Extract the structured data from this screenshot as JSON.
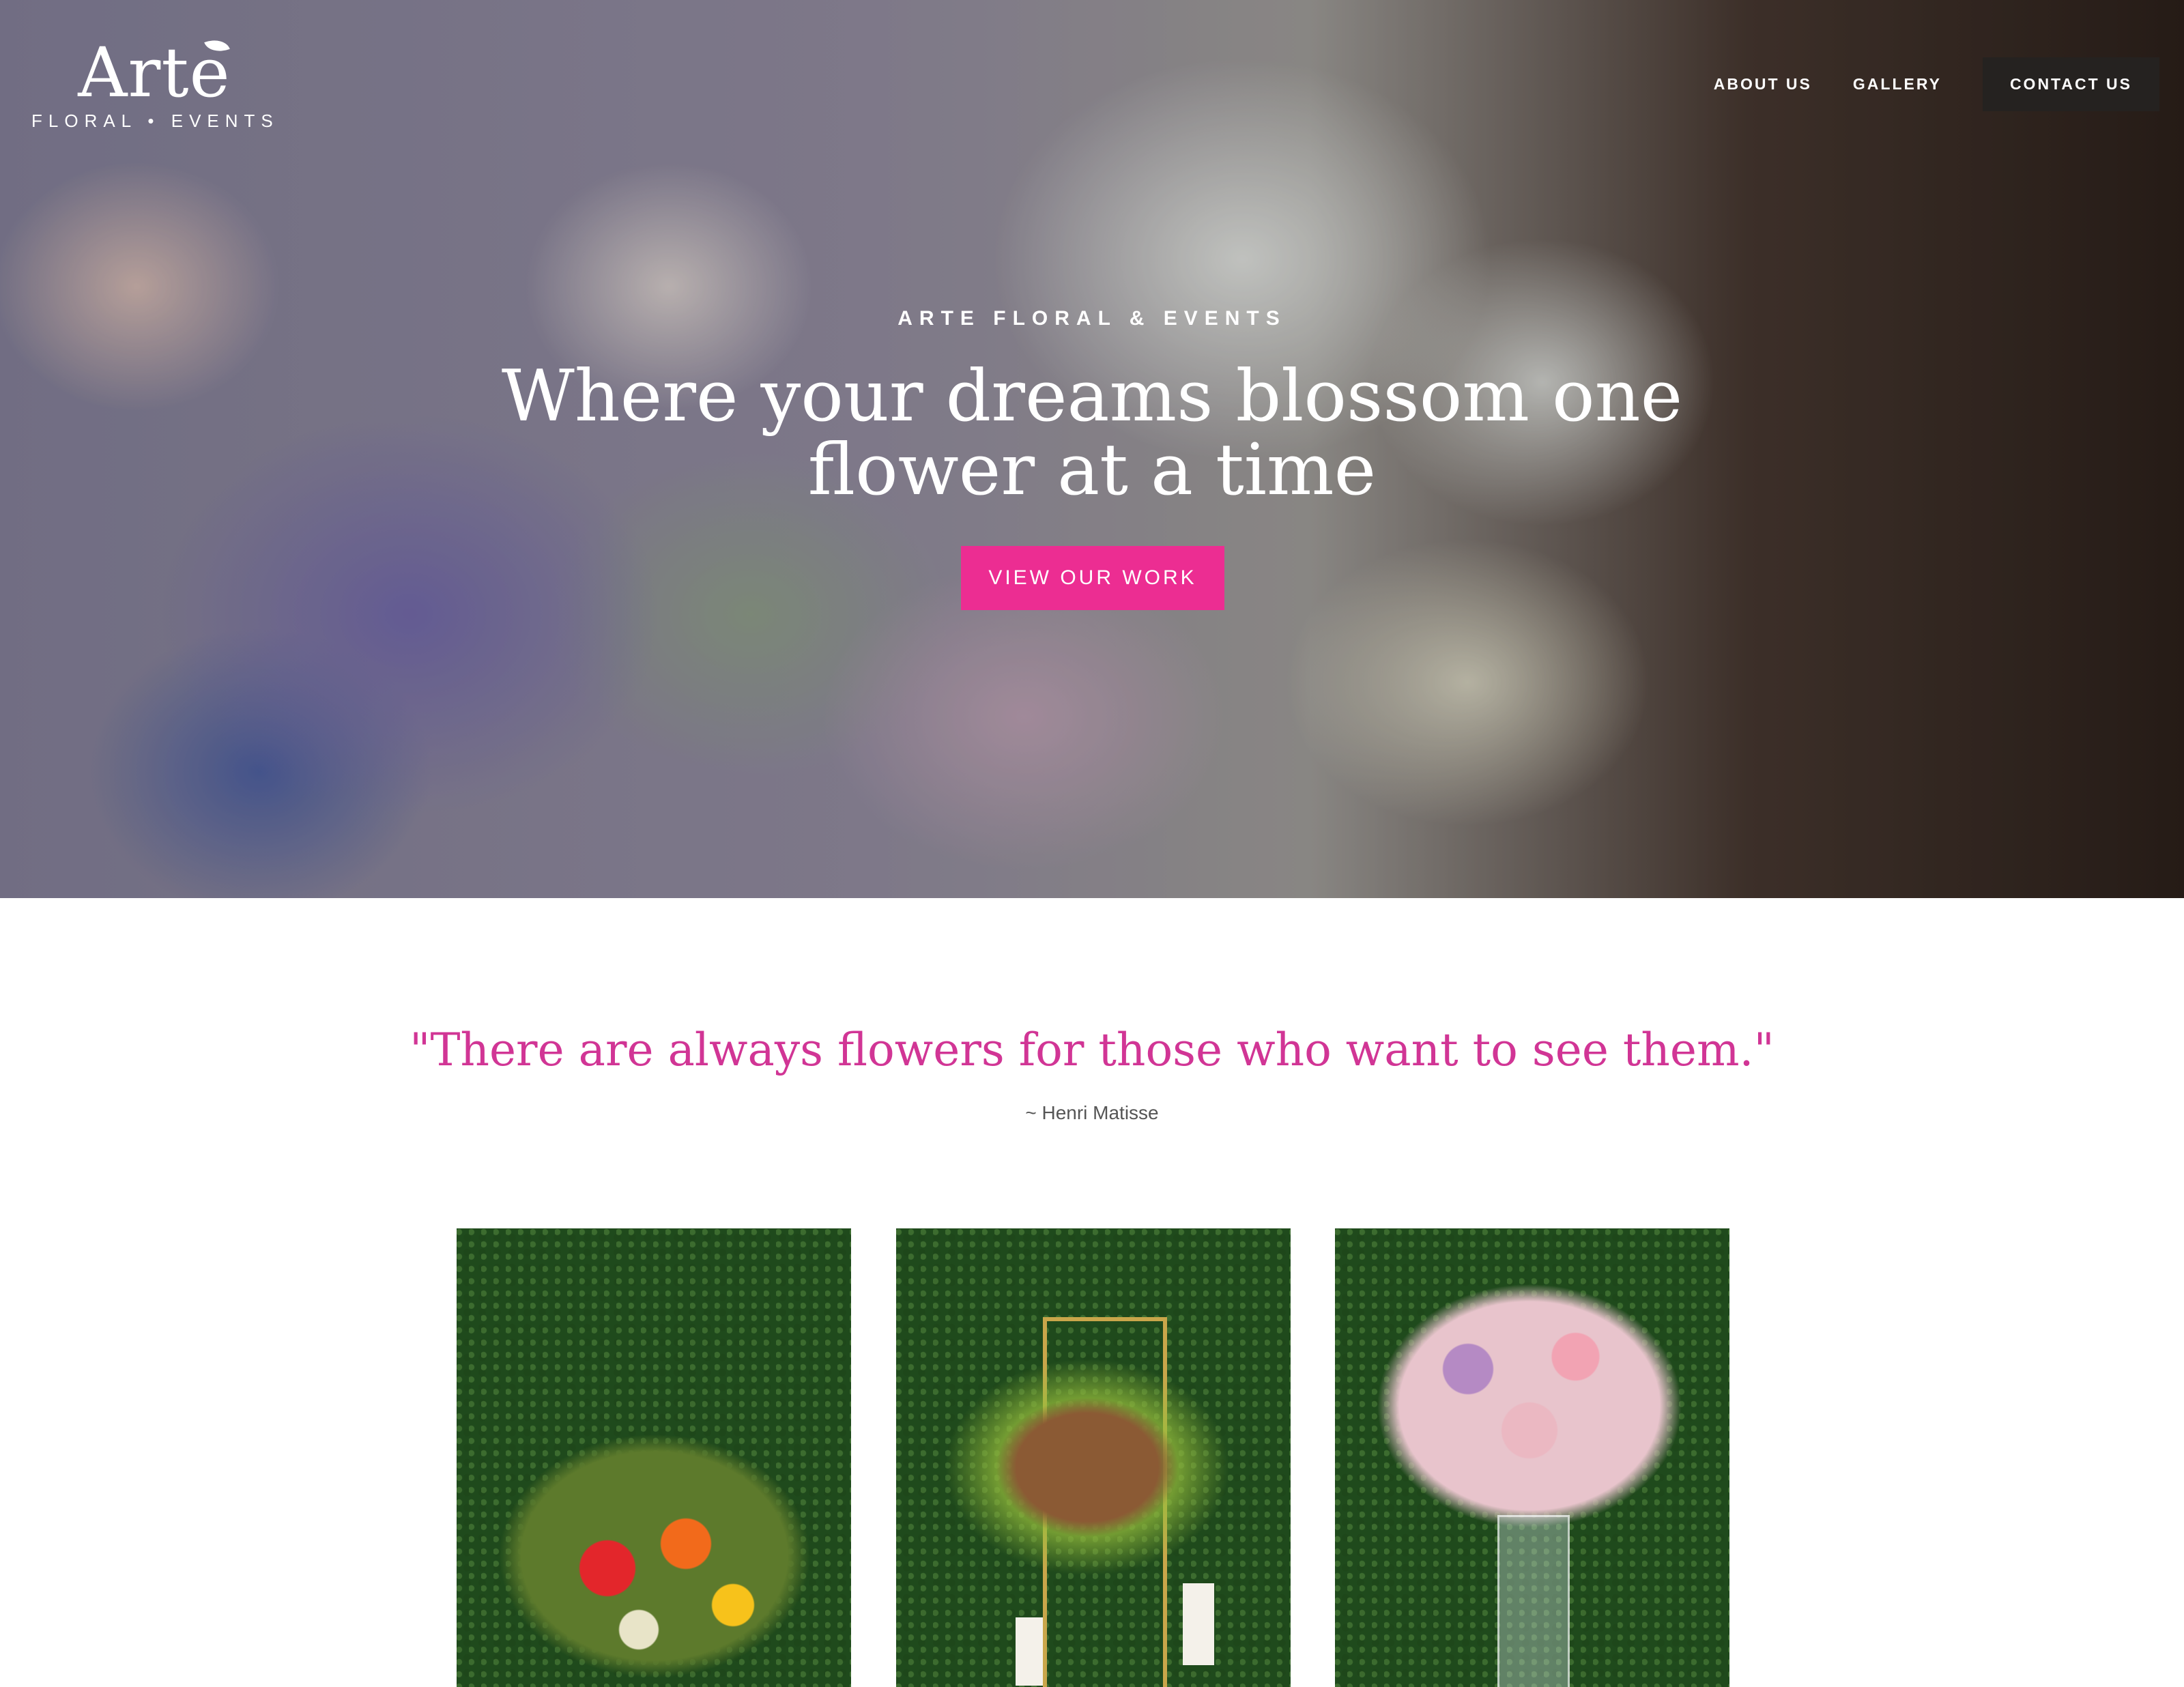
{
  "logo": {
    "name": "Arte",
    "tagline": "FLORAL • EVENTS"
  },
  "nav": {
    "about": "ABOUT US",
    "gallery": "GALLERY",
    "contact": "CONTACT US"
  },
  "hero": {
    "eyebrow": "ARTE FLORAL & EVENTS",
    "headline": "Where your dreams blossom one flower at a time",
    "cta": "VIEW OUR WORK"
  },
  "quote": {
    "text": "\"There are always flowers for those who want to see them.\"",
    "author": "~ Henri Matisse"
  },
  "gallery": [
    {
      "desc": "poppy arrangement photo"
    },
    {
      "desc": "gold frame centerpiece photo"
    },
    {
      "desc": "rose vase arrangement photo"
    }
  ],
  "colors": {
    "accent": "#ec2d92",
    "quote": "#d13595",
    "nav_bg": "#252220"
  }
}
